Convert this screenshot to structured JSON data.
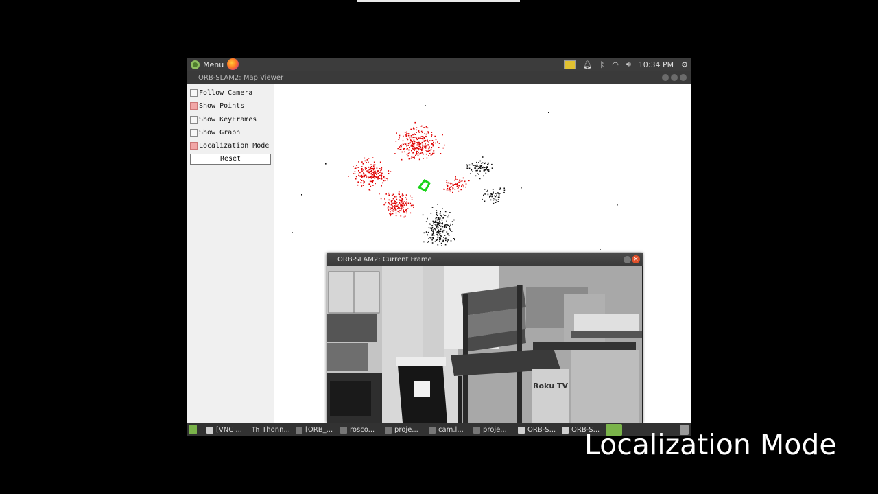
{
  "topbar": {
    "menu_label": "Menu",
    "clock": "10:34 PM"
  },
  "map_viewer": {
    "title": "ORB-SLAM2: Map Viewer",
    "options": [
      {
        "label": "Follow Camera",
        "checked": false
      },
      {
        "label": "Show Points",
        "checked": true
      },
      {
        "label": "Show KeyFrames",
        "checked": false
      },
      {
        "label": "Show Graph",
        "checked": false
      },
      {
        "label": "Localization Mode",
        "checked": true
      }
    ],
    "reset_label": "Reset"
  },
  "current_frame": {
    "title": "ORB-SLAM2: Current Frame",
    "close_glyph": "×",
    "scene_text": "Roku TV"
  },
  "taskbar": {
    "items": [
      "[VNC ...",
      "Thonn...",
      "[ORB_...",
      "rosco...",
      "proje...",
      "cam.l...",
      "proje...",
      "ORB-S...",
      "ORB-S..."
    ]
  },
  "caption": "Localization Mode",
  "icons": [
    "mint-menu-icon",
    "firefox-icon",
    "display-icon",
    "bell-icon",
    "bluetooth-icon",
    "wifi-icon",
    "volume-icon",
    "settings-gear-icon"
  ],
  "colors": {
    "map_points_red": "#e00000",
    "map_points_black": "#111111",
    "camera_green": "#19d419"
  }
}
